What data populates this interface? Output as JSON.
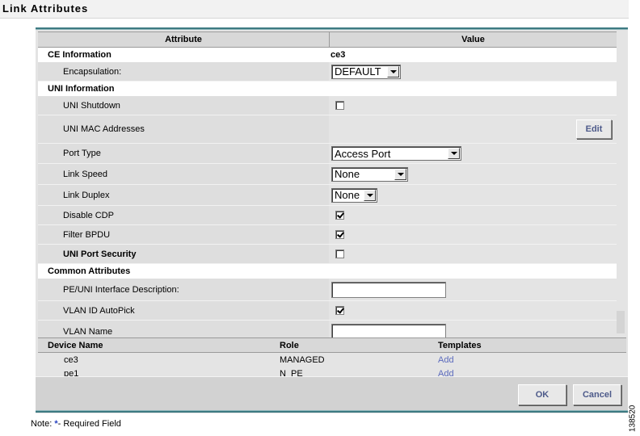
{
  "page": {
    "title": "Link Attributes",
    "note_prefix": "Note: ",
    "note_star": "*",
    "note_suffix": "- Required Field",
    "side_code": "138520"
  },
  "attr_table": {
    "header_attribute": "Attribute",
    "header_value": "Value",
    "ce_info": {
      "label": "CE Information",
      "value": "ce3"
    },
    "encapsulation": {
      "label": "Encapsulation:",
      "selected": "DEFAULT"
    },
    "uni_info": {
      "label": "UNI Information"
    },
    "uni_shutdown": {
      "label": "UNI Shutdown",
      "checked": false
    },
    "uni_mac": {
      "label": "UNI MAC Addresses",
      "button": "Edit"
    },
    "port_type": {
      "label": "Port Type",
      "selected": "Access Port"
    },
    "link_speed": {
      "label": "Link Speed",
      "selected": "None"
    },
    "link_duplex": {
      "label": "Link Duplex",
      "selected": "None"
    },
    "disable_cdp": {
      "label": "Disable CDP",
      "checked": true
    },
    "filter_bpdu": {
      "label": "Filter BPDU",
      "checked": true
    },
    "uni_port_security": {
      "label": "UNI Port Security",
      "checked": false
    },
    "common_attrs": {
      "label": "Common Attributes"
    },
    "pe_uni_desc": {
      "label": "PE/UNI Interface Description:",
      "value": ""
    },
    "vlan_autopick": {
      "label": "VLAN ID AutoPick",
      "checked": true
    },
    "vlan_name": {
      "label": "VLAN Name",
      "value": ""
    }
  },
  "device_table": {
    "headers": [
      "Device Name",
      "Role",
      "Templates"
    ],
    "rows": [
      {
        "device": "ce3",
        "role": "MANAGED",
        "template": "Add"
      },
      {
        "device": "pe1",
        "role": "N_PE",
        "template": "Add"
      }
    ]
  },
  "buttons": {
    "ok": "OK",
    "cancel": "Cancel"
  },
  "colors": {
    "accent_bar": "#3d7a82",
    "link": "#5c6bbd",
    "button_text": "#4d5a8a"
  }
}
